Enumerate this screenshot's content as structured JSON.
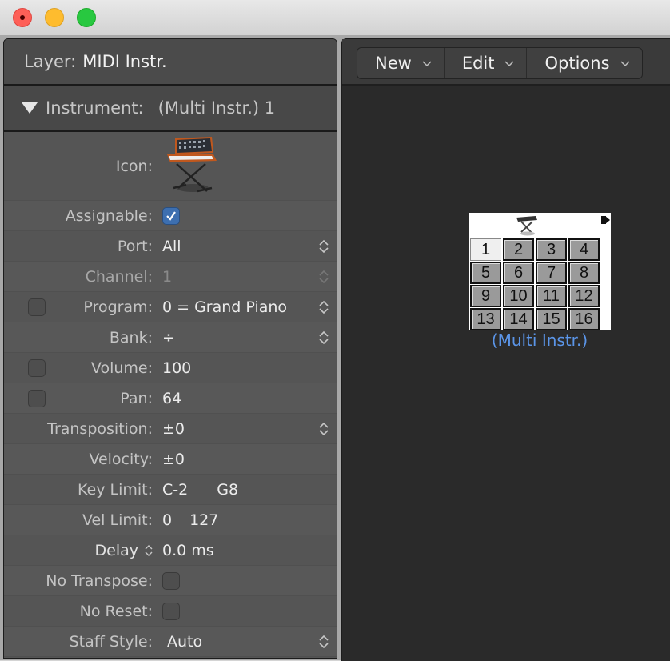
{
  "window": {
    "controls": [
      "close",
      "minimize",
      "zoom"
    ]
  },
  "inspector": {
    "layer": {
      "label": "Layer:",
      "value": "MIDI Instr."
    },
    "instrument": {
      "label": "Instrument:",
      "value": "(Multi Instr.) 1",
      "expanded": true
    },
    "rows": {
      "icon": {
        "label": "Icon:",
        "icon": "synth-keyboard-on-stand-icon"
      },
      "assignable": {
        "label": "Assignable:",
        "checked": true
      },
      "port": {
        "label": "Port:",
        "value": "All"
      },
      "channel": {
        "label": "Channel:",
        "value": "1",
        "enabled": false
      },
      "program": {
        "label": "Program:",
        "value": "0 = Grand Piano",
        "checked": false
      },
      "bank": {
        "label": "Bank:",
        "value": "÷"
      },
      "volume": {
        "label": "Volume:",
        "value": "100",
        "checked": false
      },
      "pan": {
        "label": "Pan:",
        "value": "64",
        "checked": false
      },
      "transposition": {
        "label": "Transposition:",
        "value": "±0"
      },
      "velocity": {
        "label": "Velocity:",
        "value": "±0"
      },
      "key_limit": {
        "label": "Key Limit:",
        "low": "C-2",
        "high": "G8"
      },
      "vel_limit": {
        "label": "Vel Limit:",
        "low": "0",
        "high": "127"
      },
      "delay": {
        "label": "Delay",
        "value": "0.0 ms"
      },
      "no_transpose": {
        "label": "No Transpose:",
        "checked": false
      },
      "no_reset": {
        "label": "No Reset:",
        "checked": false
      },
      "staff_style": {
        "label": "Staff Style:",
        "value": "Auto"
      }
    }
  },
  "environment": {
    "menus": [
      {
        "label": "New"
      },
      {
        "label": "Edit"
      },
      {
        "label": "Options"
      }
    ],
    "object": {
      "name": "(Multi Instr.)",
      "channels": [
        "1",
        "2",
        "3",
        "4",
        "5",
        "6",
        "7",
        "8",
        "9",
        "10",
        "11",
        "12",
        "13",
        "14",
        "15",
        "16"
      ],
      "active_channel": "1"
    },
    "colors": {
      "object_label": "#5b95e8",
      "checkbox_on": "#3d6fb0"
    }
  }
}
